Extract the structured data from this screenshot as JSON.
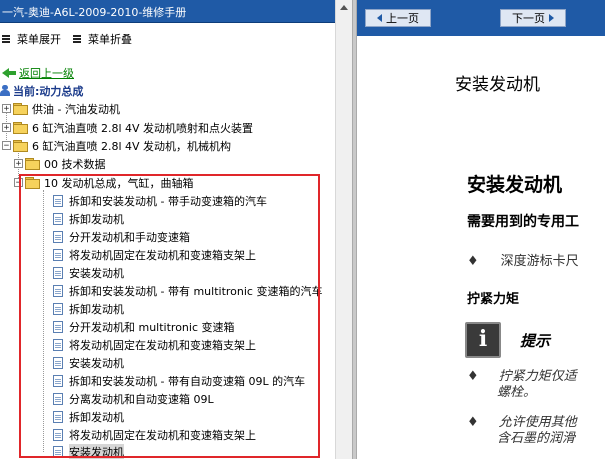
{
  "left": {
    "title": "一汽-奥迪-A6L-2009-2010-维修手册",
    "menu": {
      "expand": "菜单展开",
      "collapse": "菜单折叠"
    },
    "back": "返回上一级",
    "current": "当前:动力总成",
    "tree": [
      {
        "text": "供油 - 汽油发动机"
      },
      {
        "text": "6 缸汽油直喷 2.8l 4V 发动机喷射和点火装置"
      },
      {
        "text": "6 缸汽油直喷 2.8l 4V 发动机，机械机构"
      },
      {
        "text": "00 技术数据"
      },
      {
        "text": "10 发动机总成，气缸，曲轴箱"
      },
      {
        "text": "拆卸和安装发动机 - 带手动变速箱的汽车"
      },
      {
        "text": "拆卸发动机"
      },
      {
        "text": "分开发动机和手动变速箱"
      },
      {
        "text": "将发动机固定在发动机和变速箱支架上"
      },
      {
        "text": "安装发动机"
      },
      {
        "text": "拆卸和安装发动机 - 带有 multitronic 变速箱的汽车"
      },
      {
        "text": "拆卸发动机"
      },
      {
        "text": "分开发动机和 multitronic 变速箱"
      },
      {
        "text": "将发动机固定在发动机和变速箱支架上"
      },
      {
        "text": "安装发动机"
      },
      {
        "text": "拆卸和安装发动机 - 带有自动变速箱 09L 的汽车"
      },
      {
        "text": "分离发动机和自动变速箱 09L"
      },
      {
        "text": "拆卸发动机"
      },
      {
        "text": "将发动机固定在发动机和变速箱支架上"
      },
      {
        "text": "安装发动机"
      }
    ]
  },
  "right": {
    "prev": "上一页",
    "next": "下一页",
    "heading_top": "安装发动机",
    "heading_main": "安装发动机",
    "special_tools": "需要用到的专用工",
    "bullet1": "深度游标卡尺",
    "torque": "拧紧力矩",
    "tip": "提示",
    "bullet2_line1": "拧紧力矩仅适",
    "bullet2_line2": "螺栓。",
    "bullet3_line1": "允许使用其他",
    "bullet3_line2": "含石墨的润滑"
  }
}
